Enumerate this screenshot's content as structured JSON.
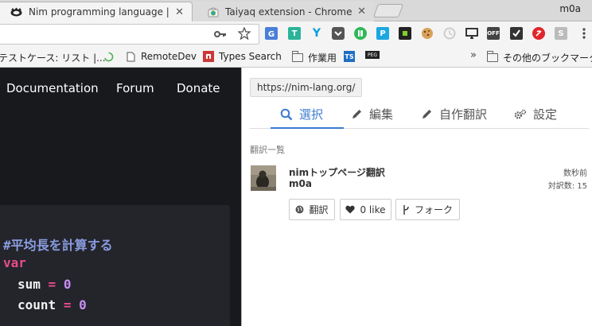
{
  "browser": {
    "tabs": [
      {
        "title": "Nim programming language | N",
        "active": true
      },
      {
        "title": "Taiyaq extension - Chrome ウ",
        "active": false
      }
    ],
    "tab_close_glyph": "✕",
    "profile_name": "m0a",
    "extensions": [
      "T",
      "P",
      "S"
    ]
  },
  "bookmarks": {
    "items": [
      {
        "label": "テストケース: リスト |..."
      },
      {
        "label": "RemoteDev"
      },
      {
        "label": "Types Search"
      },
      {
        "label": "作業用"
      },
      {
        "label": "TS"
      },
      {
        "label": "PEG"
      }
    ],
    "overflow": "»",
    "other_bookmarks": "その他のブックマーク"
  },
  "site": {
    "nav": [
      "Documentation",
      "Forum",
      "Donate"
    ],
    "code": {
      "comment": "#平均長を計算する",
      "keyword": "var",
      "lines": [
        {
          "name": "sum",
          "op": "=",
          "value": "0"
        },
        {
          "name": "count",
          "op": "=",
          "value": "0"
        }
      ]
    }
  },
  "panel": {
    "url": "https://nim-lang.org/",
    "tabs": [
      {
        "label": "選択",
        "icon": "search-icon",
        "active": true
      },
      {
        "label": "編集",
        "icon": "pencil-icon",
        "active": false
      },
      {
        "label": "自作翻訳",
        "icon": "pencil-icon",
        "active": false
      },
      {
        "label": "設定",
        "icon": "gear-icon",
        "active": false
      }
    ],
    "section_title": "翻訳一覧",
    "translation": {
      "title": "nimトップページ翻訳",
      "user": "m0a",
      "time": "数秒前",
      "count": "対訳数: 15"
    },
    "buttons": {
      "translate": "翻訳",
      "like": "0 like",
      "fork": "フォーク"
    }
  },
  "colors": {
    "accent": "#3b7bd1",
    "code_bg": "#24252b",
    "page_bg": "#18191d"
  }
}
